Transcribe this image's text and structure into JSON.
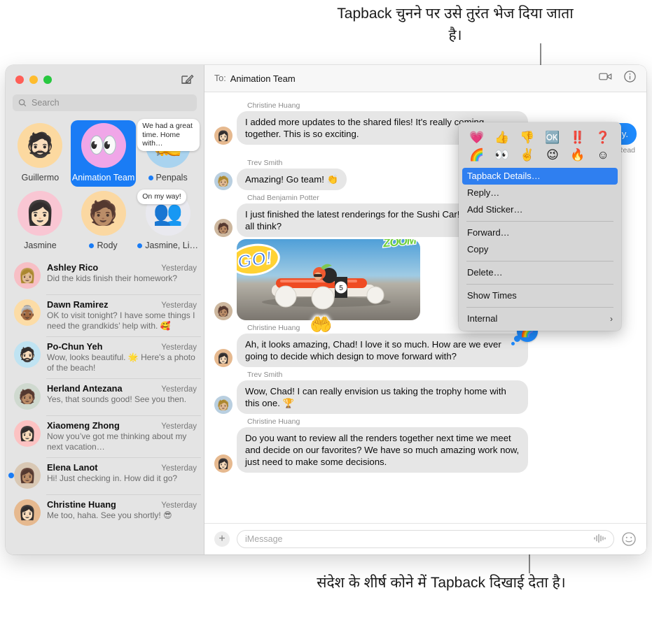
{
  "callouts": {
    "top": "Tapback चुनने पर उसे तुरंत भेज दिया जाता है।",
    "bottom": "संदेश के शीर्ष कोने में Tapback दिखाई देता है।"
  },
  "sidebar": {
    "search_placeholder": "Search",
    "compose_icon": "compose-icon",
    "pinned": [
      {
        "name": "Guillermo",
        "avatar": "🧔🏻",
        "bg": "#fcd9a0",
        "selected": false,
        "unread": false,
        "preview": ""
      },
      {
        "name": "Animation Team",
        "avatar": "👀",
        "bg": "#f0a6e8",
        "selected": true,
        "unread": false,
        "preview": ""
      },
      {
        "name": "Penpals",
        "avatar": "✍️",
        "bg": "#a9d3ef",
        "selected": false,
        "unread": true,
        "preview": "We had a great time. Home with…"
      },
      {
        "name": "Jasmine",
        "avatar": "👩🏻",
        "bg": "#f9c6d3",
        "selected": false,
        "unread": false,
        "preview": ""
      },
      {
        "name": "Rody",
        "avatar": "🧑🏽",
        "bg": "#fbd8a2",
        "selected": false,
        "unread": true,
        "preview": ""
      },
      {
        "name": "Jasmine, Li…",
        "avatar": "👥",
        "bg": "#e9e9ef",
        "selected": false,
        "unread": true,
        "preview": "On my way!"
      }
    ],
    "conversations": [
      {
        "name": "Ashley Rico",
        "time": "Yesterday",
        "preview": "Did the kids finish their homework?",
        "avatar": "👩🏼",
        "bg": "#f7bfc5",
        "unread": false
      },
      {
        "name": "Dawn Ramirez",
        "time": "Yesterday",
        "preview": "OK to visit tonight? I have some things I need the grandkids’ help with. 🥰",
        "avatar": "👵🏾",
        "bg": "#fcdca6",
        "unread": false
      },
      {
        "name": "Po-Chun Yeh",
        "time": "Yesterday",
        "preview": "Wow, looks beautiful. 🌟 Here's a photo of the beach!",
        "avatar": "🧔🏻",
        "bg": "#bfe3f2",
        "unread": false
      },
      {
        "name": "Herland Antezana",
        "time": "Yesterday",
        "preview": "Yes, that sounds good! See you then.",
        "avatar": "🧑🏽",
        "bg": "#cfd9cf",
        "unread": false
      },
      {
        "name": "Xiaomeng Zhong",
        "time": "Yesterday",
        "preview": "Now you’ve got me thinking about my next vacation…",
        "avatar": "👩🏻",
        "bg": "#fcc2c2",
        "unread": false
      },
      {
        "name": "Elena Lanot",
        "time": "Yesterday",
        "preview": "Hi! Just checking in. How did it go?",
        "avatar": "👩🏽",
        "bg": "#d9c8b4",
        "unread": true
      },
      {
        "name": "Christine Huang",
        "time": "Yesterday",
        "preview": "Me too, haha. See you shortly! 😎",
        "avatar": "👩🏻",
        "bg": "#e6b98f",
        "unread": false
      }
    ]
  },
  "thread": {
    "to_label": "To:",
    "recipient": "Animation Team",
    "facetime_icon": "video-camera-icon",
    "info_icon": "info-circle-icon",
    "messages": [
      {
        "sender": "Christine Huang",
        "text": "I added more updates to the shared files! It's really coming together. This is so exciting.",
        "side": "in",
        "avatar": "👩🏻",
        "bg": "#e6b98f"
      },
      {
        "sender": "",
        "text": "tly.",
        "side": "out",
        "status": "Read"
      },
      {
        "sender": "Trev Smith",
        "text": "Amazing! Go team! 👏",
        "side": "in",
        "avatar": "🧑🏼",
        "bg": "#b9cfe0"
      },
      {
        "sender": "Chad Benjamin Potter",
        "text": "I just finished the latest renderings for the Sushi Car! What do you all think?",
        "side": "in",
        "avatar": "🧑🏽",
        "bg": "#cdb79e"
      },
      {
        "sender": "",
        "type": "photo",
        "side": "in",
        "avatar": "🧑🏽",
        "bg": "#cdb79e",
        "stickers": [
          "GO!",
          "ZOOM",
          "🤲"
        ],
        "download_icon": "download-icon"
      },
      {
        "sender": "Christine Huang",
        "text": "Ah, it looks amazing, Chad! I love it so much. How are we ever going to decide which design to move forward with?",
        "side": "in",
        "avatar": "👩🏻",
        "bg": "#e6b98f",
        "tapback": "🌈"
      },
      {
        "sender": "Trev Smith",
        "text": "Wow, Chad! I can really envision us taking the trophy home with this one. 🏆",
        "side": "in",
        "avatar": "🧑🏼",
        "bg": "#b9cfe0"
      },
      {
        "sender": "Christine Huang",
        "text": "Do you want to review all the renders together next time we meet and decide on our favorites? We have so much amazing work now, just need to make some decisions.",
        "side": "in",
        "avatar": "👩🏻",
        "bg": "#e6b98f"
      }
    ],
    "composer": {
      "plus_label": "+",
      "placeholder": "iMessage",
      "audio_icon": "audio-waveform-icon",
      "emoji_icon": "smiley-icon"
    }
  },
  "context_menu": {
    "tapbacks": [
      "💗",
      "👍",
      "👎",
      "🆗",
      "‼️",
      "❓",
      "🌈",
      "👀",
      "✌️",
      "😉",
      "🔥",
      "☺"
    ],
    "items": [
      {
        "label": "Tapback Details…",
        "highlighted": true,
        "separator_after": false,
        "submenu": false
      },
      {
        "label": "Reply…",
        "highlighted": false,
        "separator_after": false,
        "submenu": false
      },
      {
        "label": "Add Sticker…",
        "highlighted": false,
        "separator_after": true,
        "submenu": false
      },
      {
        "label": "Forward…",
        "highlighted": false,
        "separator_after": false,
        "submenu": false
      },
      {
        "label": "Copy",
        "highlighted": false,
        "separator_after": true,
        "submenu": false
      },
      {
        "label": "Delete…",
        "highlighted": false,
        "separator_after": true,
        "submenu": false
      },
      {
        "label": "Show Times",
        "highlighted": false,
        "separator_after": true,
        "submenu": false
      },
      {
        "label": "Internal",
        "highlighted": false,
        "separator_after": false,
        "submenu": true
      }
    ]
  },
  "colors": {
    "accent": "#1e8bff",
    "menu_highlight": "#2f7ff0",
    "sidebar_bg": "#e4e4e4",
    "bubble_in": "#e6e6e6"
  }
}
